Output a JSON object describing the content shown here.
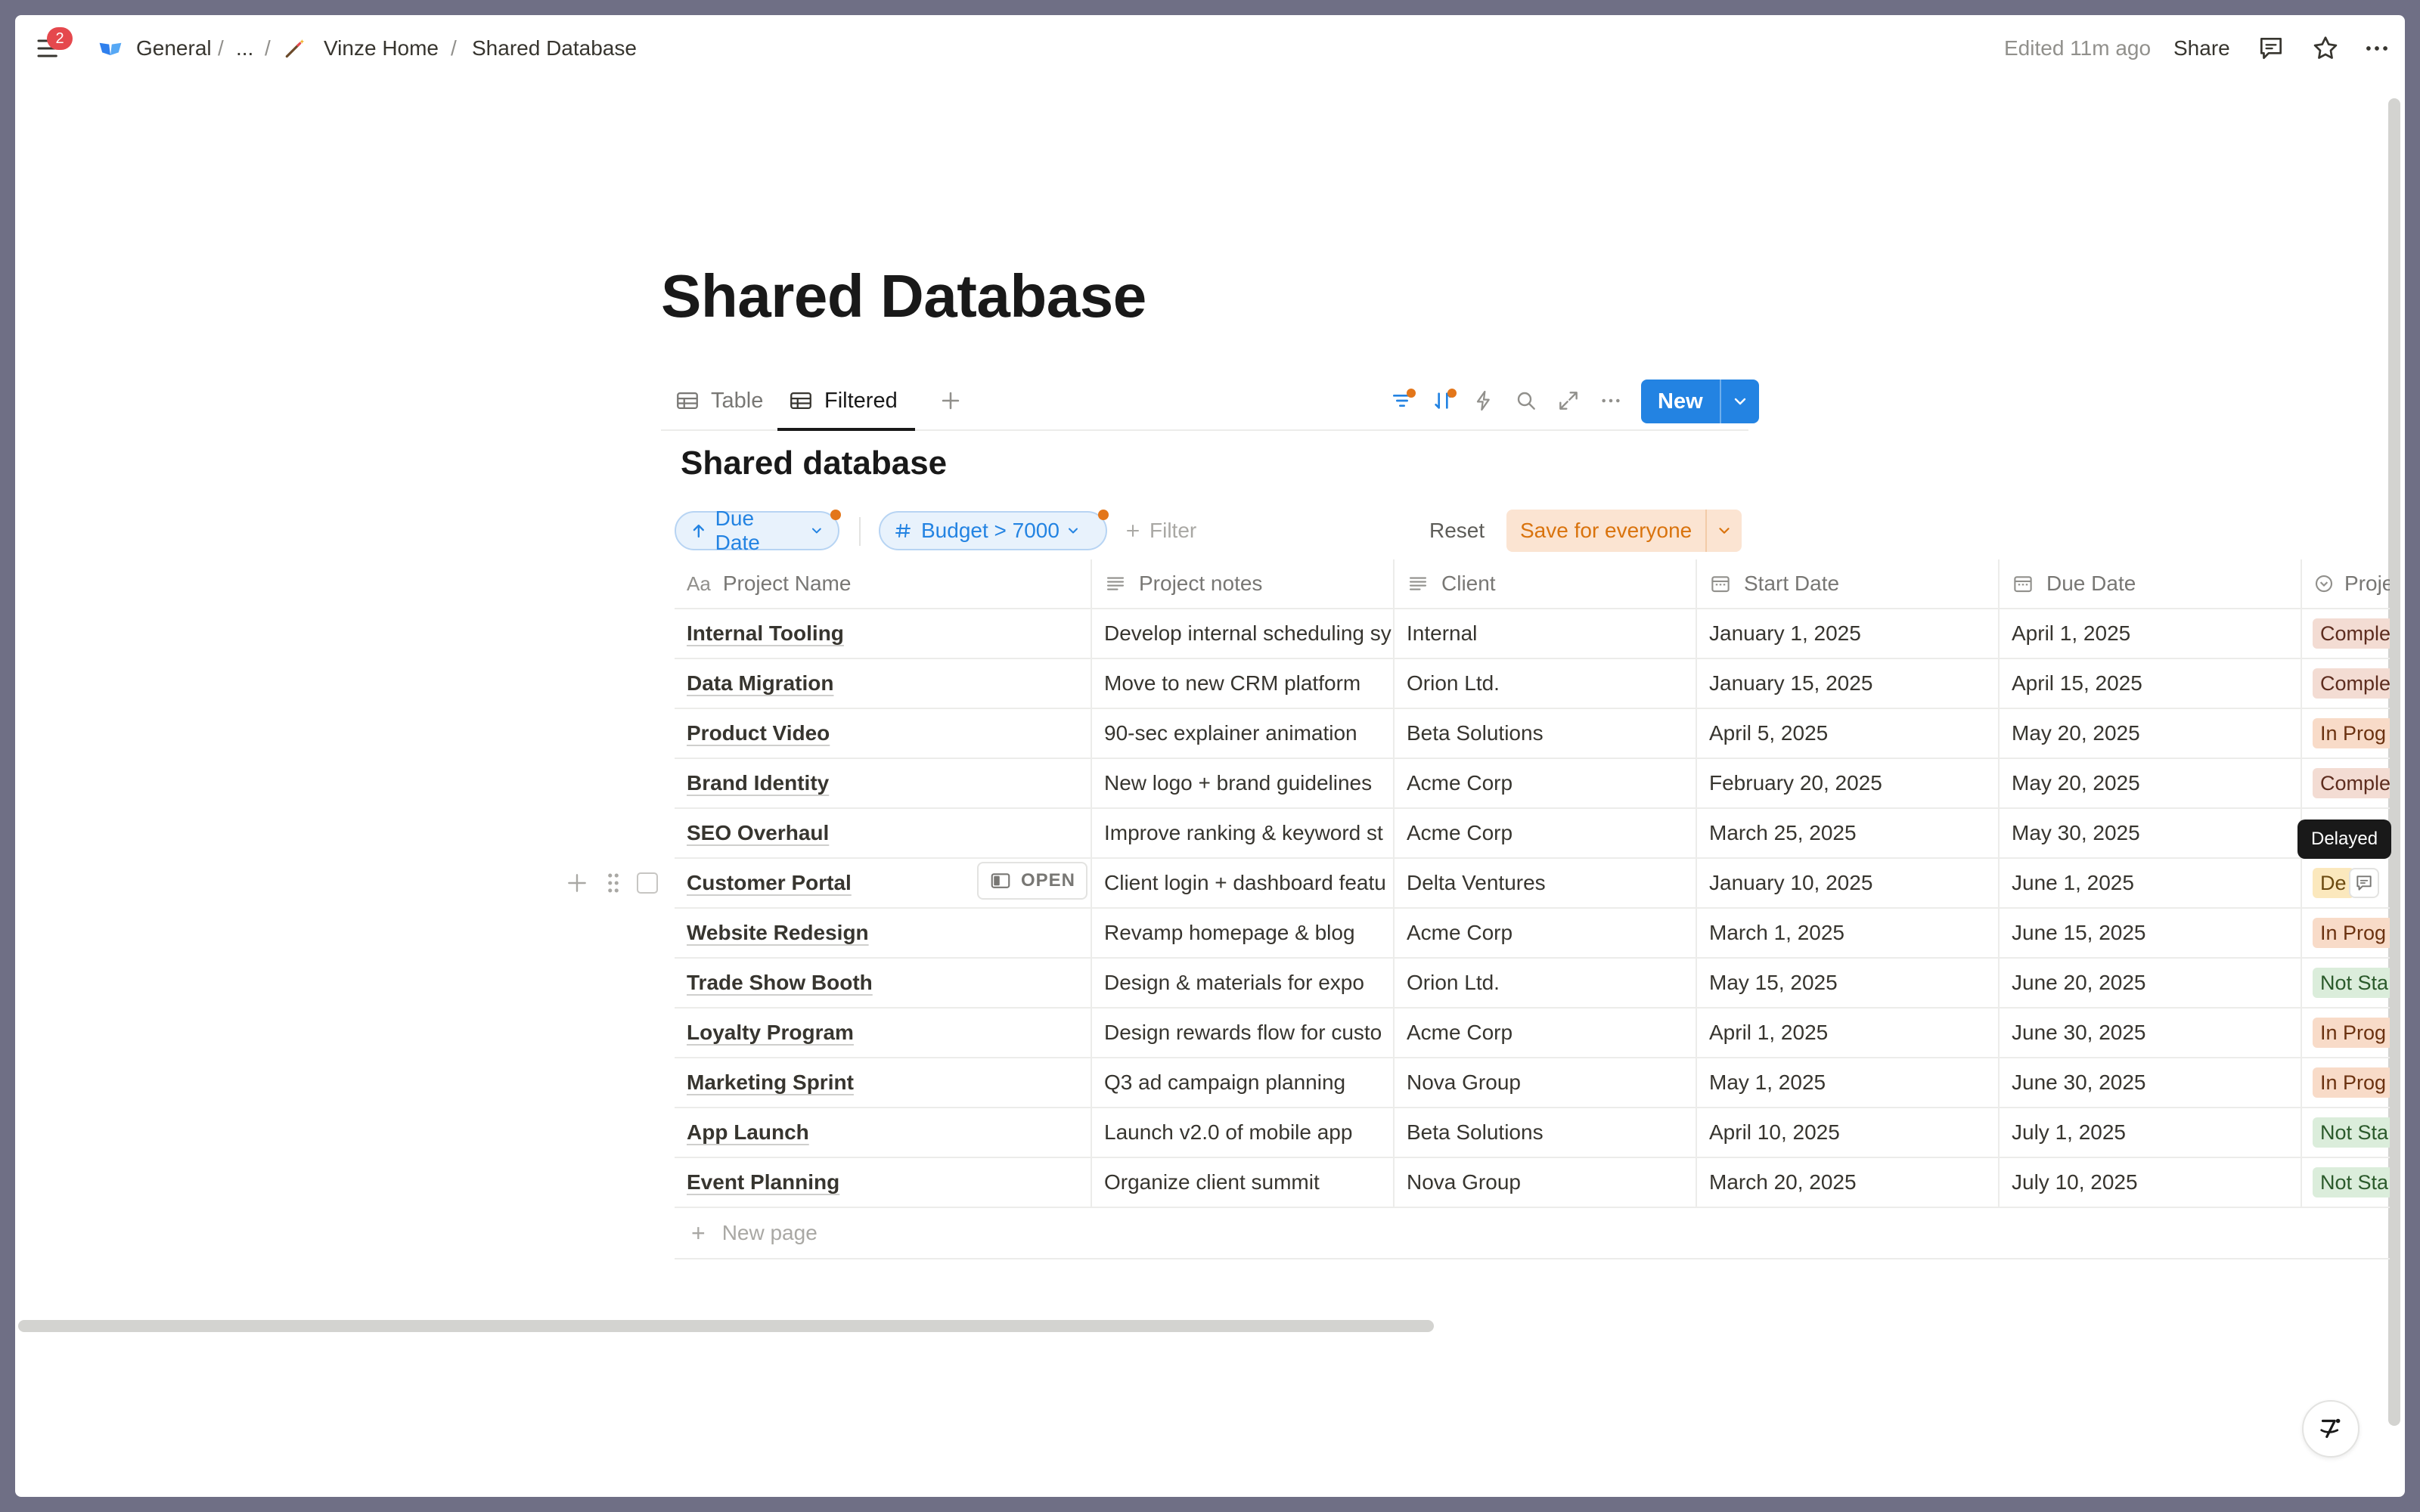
{
  "topbar": {
    "notification_count": "2",
    "breadcrumb": {
      "workspace": "General",
      "separator": "/",
      "ellipsis": "...",
      "parent": "Vinze Home",
      "current": "Shared Database"
    },
    "edited": "Edited 11m ago",
    "share_label": "Share"
  },
  "page": {
    "title": "Shared Database",
    "views": [
      {
        "label": "Table"
      },
      {
        "label": "Filtered"
      }
    ],
    "new_label": "New",
    "db_title": "Shared database"
  },
  "filters": {
    "sort_label": "Due Date",
    "budget_label": "Budget > 7000",
    "add_filter_label": "Filter",
    "reset_label": "Reset",
    "save_label": "Save for everyone"
  },
  "table": {
    "columns": [
      {
        "name": "Project Name",
        "prefix": "Aa"
      },
      {
        "name": "Project notes"
      },
      {
        "name": "Client"
      },
      {
        "name": "Start Date"
      },
      {
        "name": "Due Date"
      },
      {
        "name": "Proje"
      }
    ],
    "rows": [
      {
        "name": "Internal Tooling",
        "notes": "Develop internal scheduling sy",
        "client": "Internal",
        "start": "January 1, 2025",
        "due": "April 1, 2025",
        "status": "Comple",
        "status_kind": "complete"
      },
      {
        "name": "Data Migration",
        "notes": "Move to new CRM platform",
        "client": "Orion Ltd.",
        "start": "January 15, 2025",
        "due": "April 15, 2025",
        "status": "Comple",
        "status_kind": "complete"
      },
      {
        "name": "Product Video",
        "notes": "90-sec explainer animation",
        "client": "Beta Solutions",
        "start": "April 5, 2025",
        "due": "May 20, 2025",
        "status": "In Prog",
        "status_kind": "inprog"
      },
      {
        "name": "Brand Identity",
        "notes": "New logo + brand guidelines",
        "client": "Acme Corp",
        "start": "February 20, 2025",
        "due": "May 20, 2025",
        "status": "Comple",
        "status_kind": "complete"
      },
      {
        "name": "SEO Overhaul",
        "notes": "Improve ranking & keyword st",
        "client": "Acme Corp",
        "start": "March 25, 2025",
        "due": "May 30, 2025",
        "status": "",
        "status_kind": "none"
      },
      {
        "name": "Customer Portal",
        "notes": "Client login + dashboard featu",
        "client": "Delta Ventures",
        "start": "January 10, 2025",
        "due": "June 1, 2025",
        "status": "De",
        "status_kind": "delayed"
      },
      {
        "name": "Website Redesign",
        "notes": "Revamp homepage & blog",
        "client": "Acme Corp",
        "start": "March 1, 2025",
        "due": "June 15, 2025",
        "status": "In Prog",
        "status_kind": "inprog"
      },
      {
        "name": "Trade Show Booth",
        "notes": "Design & materials for expo",
        "client": "Orion Ltd.",
        "start": "May 15, 2025",
        "due": "June 20, 2025",
        "status": "Not Sta",
        "status_kind": "notstart"
      },
      {
        "name": "Loyalty Program",
        "notes": "Design rewards flow for custo",
        "client": "Acme Corp",
        "start": "April 1, 2025",
        "due": "June 30, 2025",
        "status": "In Prog",
        "status_kind": "inprog"
      },
      {
        "name": "Marketing Sprint",
        "notes": "Q3 ad campaign planning",
        "client": "Nova Group",
        "start": "May 1, 2025",
        "due": "June 30, 2025",
        "status": "In Prog",
        "status_kind": "inprog"
      },
      {
        "name": "App Launch",
        "notes": "Launch v2.0 of mobile app",
        "client": "Beta Solutions",
        "start": "April 10, 2025",
        "due": "July 1, 2025",
        "status": "Not Sta",
        "status_kind": "notstart"
      },
      {
        "name": "Event Planning",
        "notes": "Organize client summit",
        "client": "Nova Group",
        "start": "March 20, 2025",
        "due": "July 10, 2025",
        "status": "Not Sta",
        "status_kind": "notstart"
      }
    ],
    "open_label": "OPEN",
    "tooltip": "Delayed",
    "new_page_label": "New page"
  },
  "colors": {
    "accent": "#2383e2",
    "indicator": "#e3761a",
    "badge": "#e5484d"
  }
}
